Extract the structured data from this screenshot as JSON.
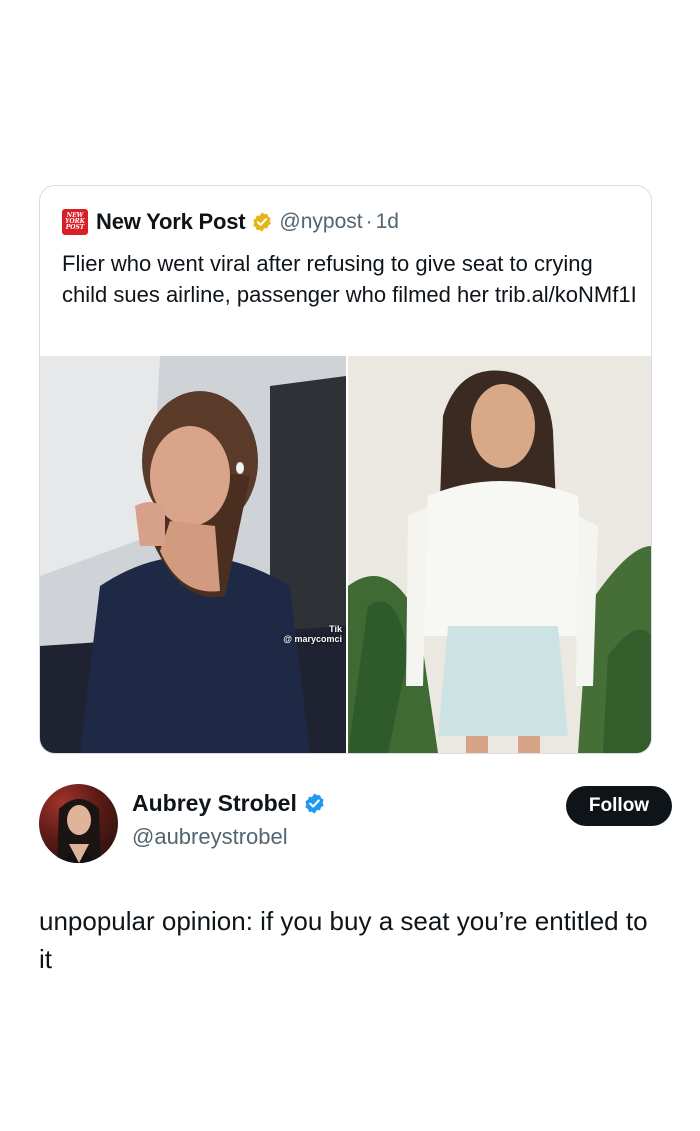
{
  "quoted_tweet": {
    "logo_text": [
      "NEW",
      "YORK",
      "POST"
    ],
    "name": "New York Post",
    "handle": "@nypost",
    "separator": "·",
    "time": "1d",
    "text": "Flier who went viral after refusing to give seat to crying child sues airline, passenger who filmed her trib.al/koNMf1I",
    "images": [
      {
        "watermark_logo": "Tik",
        "watermark_user": "@ marycomci"
      },
      {}
    ]
  },
  "author": {
    "name": "Aubrey Strobel",
    "handle": "@aubreystrobel",
    "follow_label": "Follow"
  },
  "tweet": {
    "text": "unpopular opinion: if you buy a seat you’re entitled to it"
  },
  "colors": {
    "brand_red": "#d81f26",
    "verified_gold": "#e2b719",
    "verified_blue": "#1d9bf0",
    "follow_bg": "#0f1419"
  }
}
